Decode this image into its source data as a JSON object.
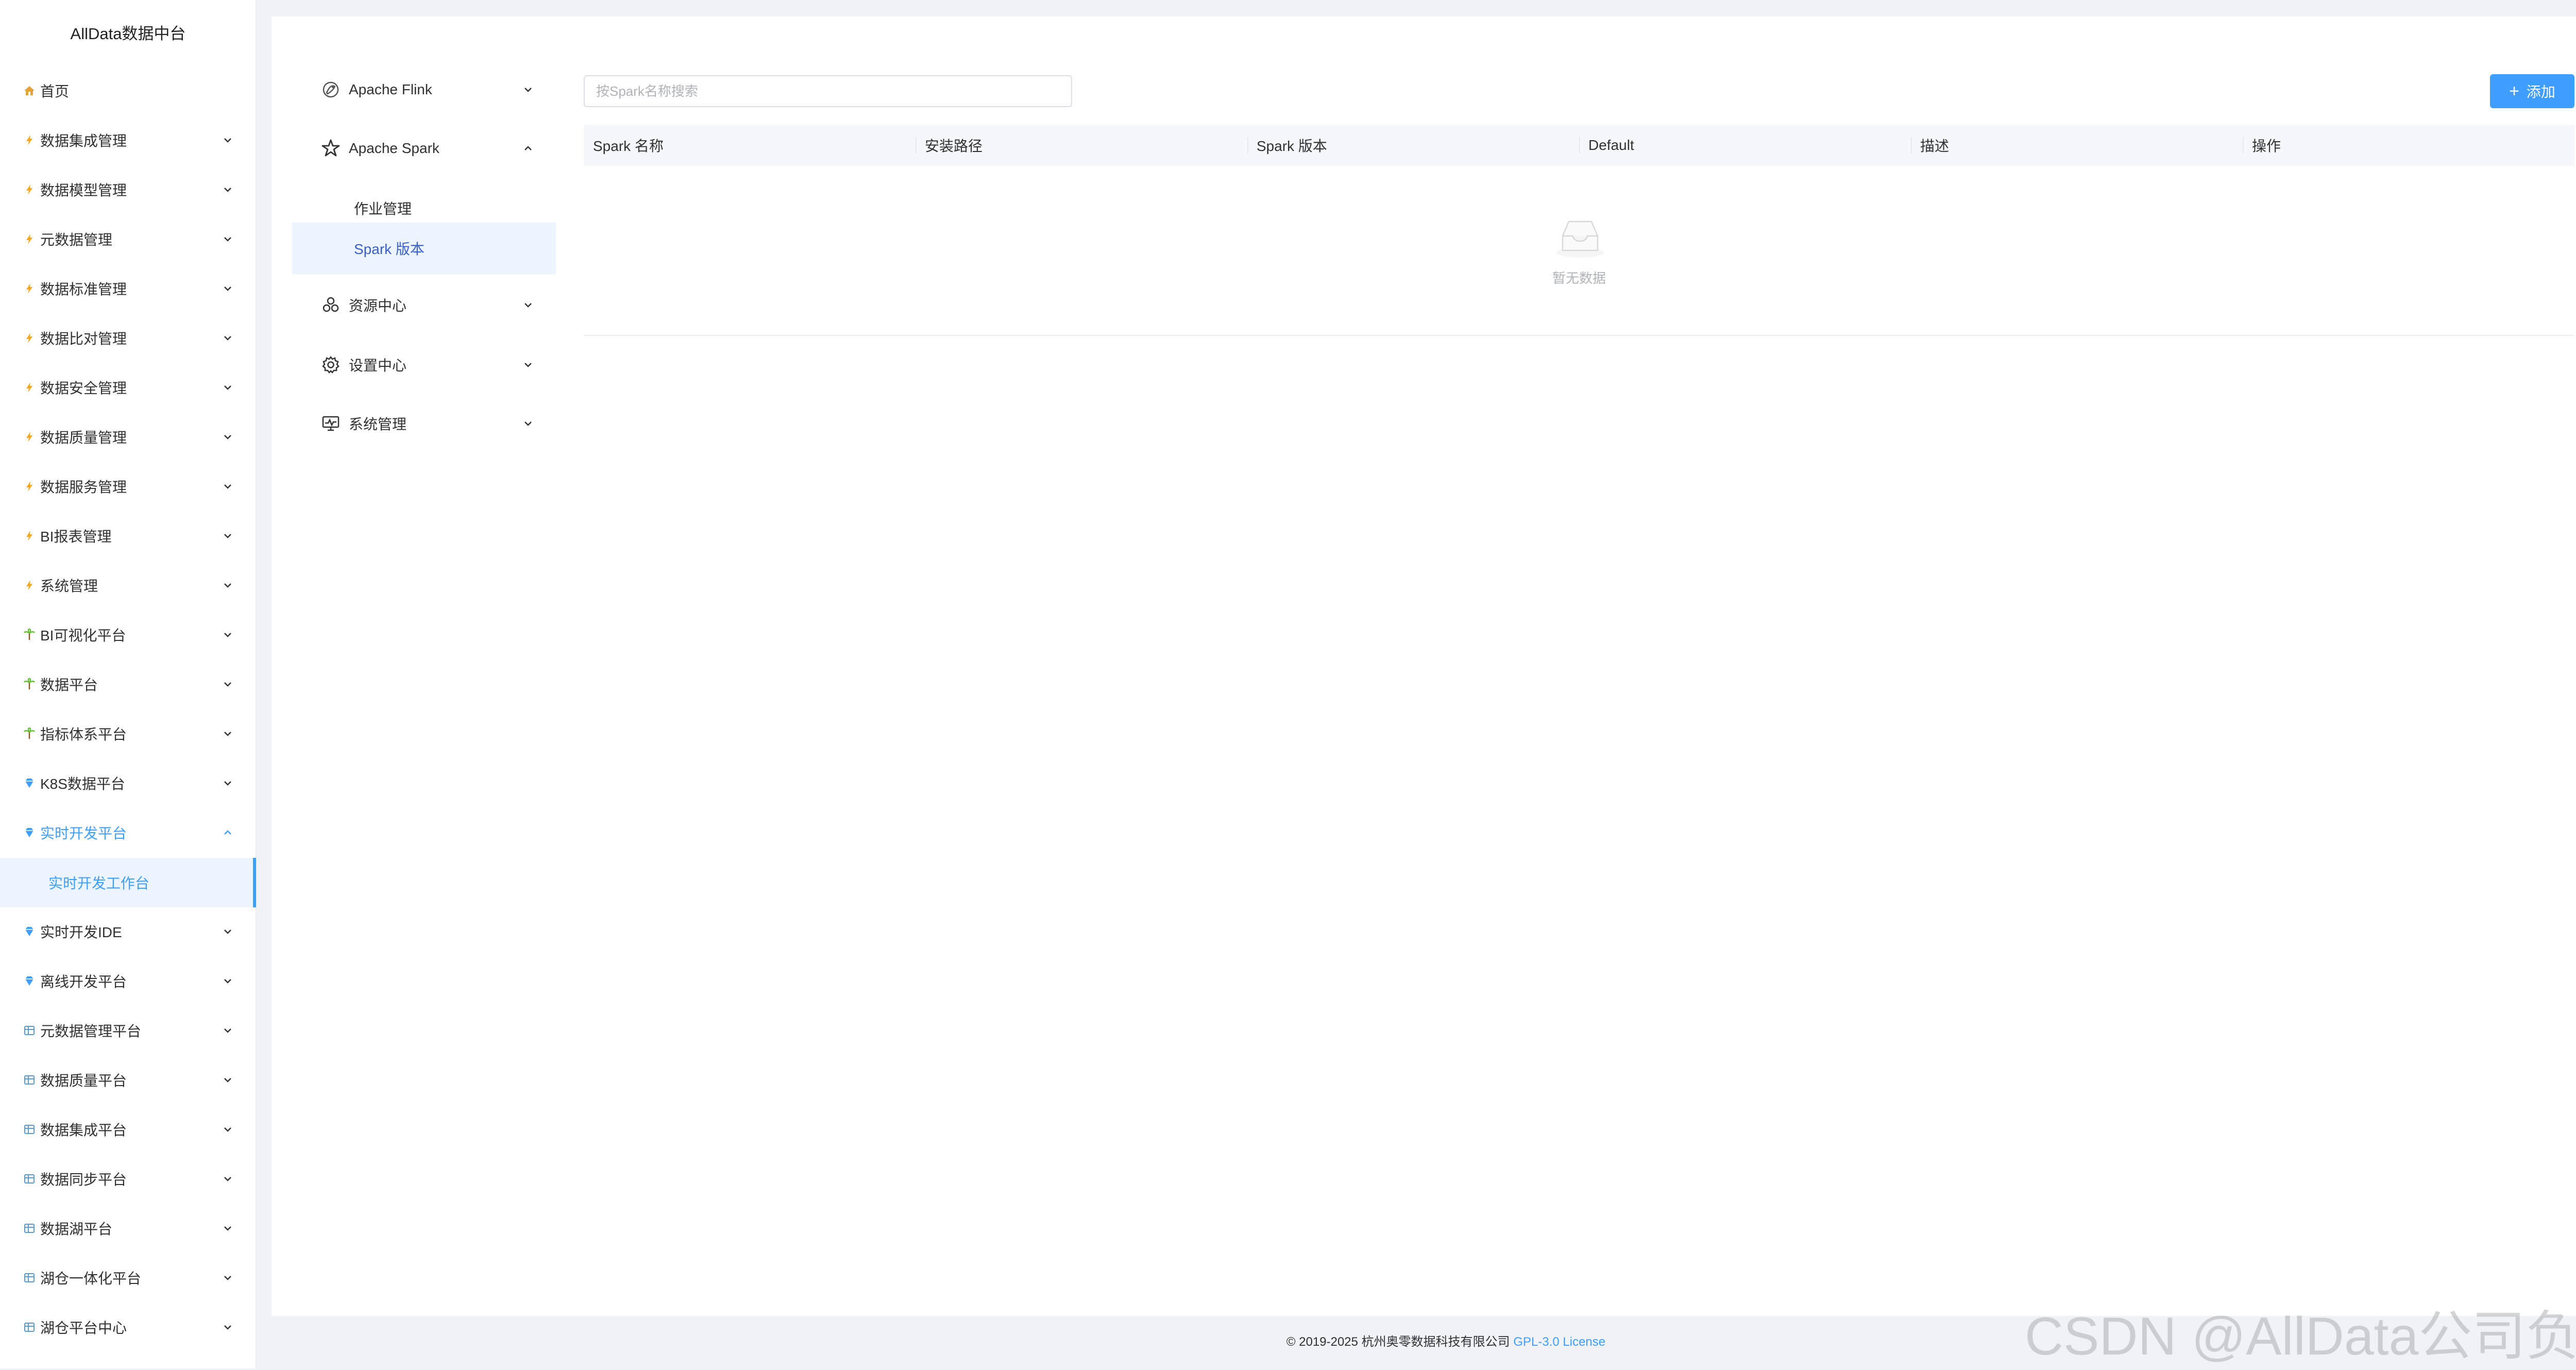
{
  "app": {
    "title": "AllData数据中台"
  },
  "sidebar": {
    "items": [
      {
        "label": "首页",
        "icon": "home-icon",
        "icon_color": "#e6a23c",
        "has_chevron": false
      },
      {
        "label": "数据集成管理",
        "icon": "lightning-icon",
        "icon_color": "#f5a623",
        "has_chevron": true
      },
      {
        "label": "数据模型管理",
        "icon": "lightning-icon",
        "icon_color": "#f5a623",
        "has_chevron": true
      },
      {
        "label": "元数据管理",
        "icon": "lightning-icon",
        "icon_color": "#f5a623",
        "has_chevron": true
      },
      {
        "label": "数据标准管理",
        "icon": "lightning-icon",
        "icon_color": "#f5a623",
        "has_chevron": true
      },
      {
        "label": "数据比对管理",
        "icon": "lightning-icon",
        "icon_color": "#f5a623",
        "has_chevron": true
      },
      {
        "label": "数据安全管理",
        "icon": "lightning-icon",
        "icon_color": "#f5a623",
        "has_chevron": true
      },
      {
        "label": "数据质量管理",
        "icon": "lightning-icon",
        "icon_color": "#f5a623",
        "has_chevron": true
      },
      {
        "label": "数据服务管理",
        "icon": "lightning-icon",
        "icon_color": "#f5a623",
        "has_chevron": true
      },
      {
        "label": "BI报表管理",
        "icon": "lightning-icon",
        "icon_color": "#f5a623",
        "has_chevron": true
      },
      {
        "label": "系统管理",
        "icon": "lightning-icon",
        "icon_color": "#f5a623",
        "has_chevron": true
      },
      {
        "label": "BI可视化平台",
        "icon": "palm-tree-icon",
        "icon_color": "#67c23a",
        "has_chevron": true
      },
      {
        "label": "数据平台",
        "icon": "palm-tree-icon",
        "icon_color": "#67c23a",
        "has_chevron": true
      },
      {
        "label": "指标体系平台",
        "icon": "palm-tree-icon",
        "icon_color": "#67c23a",
        "has_chevron": true
      },
      {
        "label": "K8S数据平台",
        "icon": "diamond-icon",
        "icon_color": "#409eff",
        "has_chevron": true
      },
      {
        "label": "实时开发平台",
        "icon": "diamond-icon",
        "icon_color": "#409eff",
        "has_chevron": true,
        "expanded": true
      },
      {
        "label": "实时开发IDE",
        "icon": "diamond-icon",
        "icon_color": "#409eff",
        "has_chevron": true
      },
      {
        "label": "离线开发平台",
        "icon": "diamond-icon",
        "icon_color": "#409eff",
        "has_chevron": true
      },
      {
        "label": "元数据管理平台",
        "icon": "grid-icon",
        "icon_color": "#5b9bd5",
        "has_chevron": true
      },
      {
        "label": "数据质量平台",
        "icon": "grid-icon",
        "icon_color": "#5b9bd5",
        "has_chevron": true
      },
      {
        "label": "数据集成平台",
        "icon": "grid-icon",
        "icon_color": "#5b9bd5",
        "has_chevron": true
      },
      {
        "label": "数据同步平台",
        "icon": "grid-icon",
        "icon_color": "#5b9bd5",
        "has_chevron": true
      },
      {
        "label": "数据湖平台",
        "icon": "grid-icon",
        "icon_color": "#5b9bd5",
        "has_chevron": true
      },
      {
        "label": "湖仓一体化平台",
        "icon": "grid-icon",
        "icon_color": "#5b9bd5",
        "has_chevron": true
      },
      {
        "label": "湖仓平台中心",
        "icon": "grid-icon",
        "icon_color": "#5b9bd5",
        "has_chevron": true
      }
    ],
    "active_sub": "实时开发工作台"
  },
  "submenu": {
    "items": [
      {
        "label": "Apache Flink",
        "icon": "flink-squirrel-icon",
        "expanded": false
      },
      {
        "label": "Apache Spark",
        "icon": "spark-star-icon",
        "expanded": true
      },
      {
        "label": "资源中心",
        "icon": "cubes-icon",
        "expanded": false
      },
      {
        "label": "设置中心",
        "icon": "gear-icon",
        "expanded": false
      },
      {
        "label": "系统管理",
        "icon": "monitor-icon",
        "expanded": false
      }
    ],
    "spark_children": [
      {
        "label": "作业管理",
        "selected": false
      },
      {
        "label": "Spark 版本",
        "selected": true
      }
    ]
  },
  "toolbar": {
    "search_placeholder": "按Spark名称搜索",
    "add_label": "添加"
  },
  "table": {
    "columns": [
      "Spark 名称",
      "安装路径",
      "Spark 版本",
      "Default",
      "描述",
      "操作"
    ],
    "rows": [],
    "empty_text": "暂无数据"
  },
  "footer": {
    "copyright": "© 2019-2025 杭州奥零数据科技有限公司",
    "license": "GPL-3.0 License"
  },
  "watermark": "CSDN @AllData公司负责人",
  "colors": {
    "accent": "#409eff",
    "selected_bg": "#ecf5ff"
  }
}
